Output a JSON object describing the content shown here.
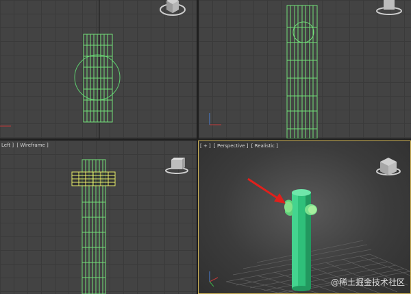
{
  "viewports": {
    "top_left": {
      "label_parts": []
    },
    "top_right": {
      "label_parts": []
    },
    "bottom_left": {
      "label_parts": [
        "Left ]",
        "[ Wireframe ]"
      ]
    },
    "bottom_right": {
      "label_parts": [
        "[ + ]",
        "[ Perspective ]",
        "[ Realistic ]"
      ],
      "active": true
    }
  },
  "watermark": "@稀土掘金技术社区",
  "colors": {
    "viewport_bg": "#434343",
    "grid": "#3a3a3a",
    "wire": "#73e07a",
    "active_border": "#d4b85a",
    "solid_green": "#2fc07a",
    "arrow": "#e0201c"
  },
  "icons": [
    "viewcube-icon",
    "axis-gizmo-icon",
    "red-arrow-annotation"
  ]
}
